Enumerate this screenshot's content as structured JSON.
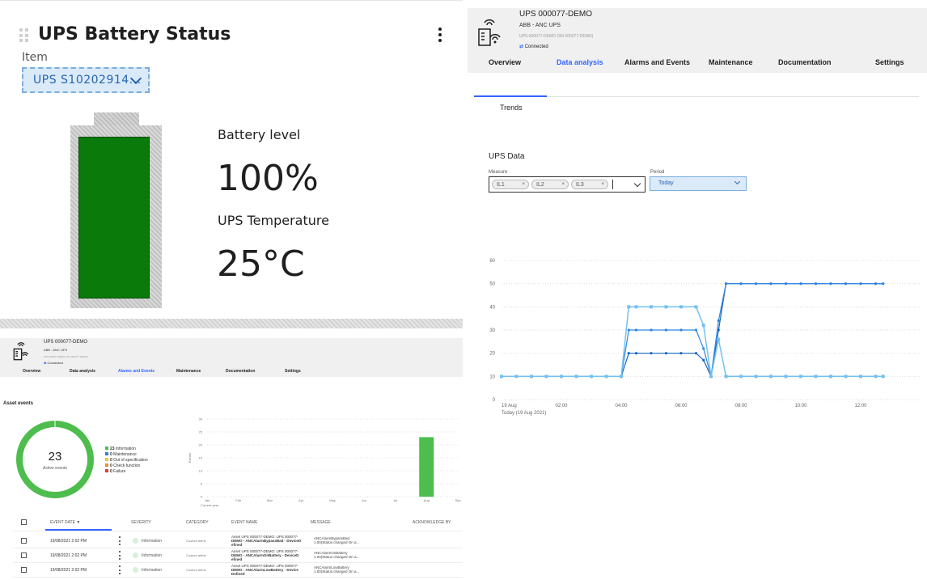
{
  "battery_widget": {
    "title": "UPS Battery Status",
    "item_label": "Item",
    "item_value": "UPS S10202914...",
    "battery_level_label": "Battery level",
    "battery_level_value": "100%",
    "battery_level_fraction": 1.0,
    "temperature_label": "UPS Temperature",
    "temperature_value": "25°C",
    "colors": {
      "battery_fill": "#0a7a0a",
      "select_bg": "#dbeaf8",
      "select_text": "#2566b0"
    },
    "icons": [
      "drag-handle-icon",
      "more-vertical-icon",
      "chevron-down-icon"
    ]
  },
  "asset_header": {
    "name": "UPS 000077-DEMO",
    "model": "ABB - ANC UPS",
    "serial": "UPS 000077-DEMO (SN 000077-DEMO)",
    "status": "Connected",
    "icons": [
      "ups-device-icon",
      "wifi-icon",
      "connected-arrows-icon"
    ]
  },
  "tabs": [
    {
      "label": "Overview"
    },
    {
      "label": "Data analysis"
    },
    {
      "label": "Alarms and Events"
    },
    {
      "label": "Maintenance"
    },
    {
      "label": "Documentation"
    },
    {
      "label": "Settings"
    }
  ],
  "data_analysis": {
    "subtab": "Trends",
    "section_title": "UPS Data",
    "measure_label": "Measure",
    "measure_tags": [
      "IL1",
      "IL2",
      "IL3"
    ],
    "period_label": "Period",
    "period_value": "Today",
    "x_caption": "Today (19 Aug 2021)",
    "colors": {
      "IL1": "#1565c0",
      "IL2": "#2e86de",
      "IL3": "#74c0f0"
    }
  },
  "chart_data": [
    {
      "type": "line",
      "title": "",
      "xlabel": "Today (19 Aug 2021)",
      "ylabel": "",
      "ylim": [
        0,
        60
      ],
      "y_ticks": [
        "0",
        "10",
        "20",
        "30",
        "40",
        "50",
        "60"
      ],
      "x_ticks": [
        "19 Aug",
        "02:00",
        "04:00",
        "06:00",
        "08:00",
        "10:00",
        "12:00"
      ],
      "x": [
        "00:00",
        "00:30",
        "01:00",
        "01:30",
        "02:00",
        "02:30",
        "03:00",
        "03:30",
        "04:00",
        "04:15",
        "04:30",
        "05:00",
        "05:30",
        "06:00",
        "06:30",
        "06:45",
        "07:00",
        "07:15",
        "07:30",
        "08:00",
        "08:30",
        "09:00",
        "09:30",
        "10:00",
        "10:30",
        "11:00",
        "11:30",
        "12:00",
        "12:30",
        "12:45"
      ],
      "series": [
        {
          "values": [
            10,
            10,
            10,
            10,
            10,
            10,
            10,
            10,
            10,
            20,
            20,
            20,
            20,
            20,
            20,
            17,
            10,
            30,
            50,
            50,
            50,
            50,
            50,
            50,
            50,
            50,
            50,
            50,
            50,
            50
          ]
        },
        {
          "values": [
            10,
            10,
            10,
            10,
            10,
            10,
            10,
            10,
            10,
            30,
            30,
            30,
            30,
            30,
            30,
            22,
            10,
            34,
            50,
            50,
            50,
            50,
            50,
            50,
            50,
            50,
            50,
            50,
            50,
            50
          ]
        },
        {
          "values": [
            10,
            10,
            10,
            10,
            10,
            10,
            10,
            10,
            10,
            40,
            40,
            40,
            40,
            40,
            40,
            32,
            10,
            26,
            10,
            10,
            10,
            10,
            10,
            10,
            10,
            10,
            10,
            10,
            10,
            10
          ]
        }
      ],
      "grid": true
    },
    {
      "type": "bar",
      "title": "",
      "xlabel": "Current year",
      "ylabel": "Events",
      "categories": [
        "Jan",
        "Feb",
        "Mar",
        "Apr",
        "May",
        "Jun",
        "Jul",
        "Aug",
        "Sep"
      ],
      "x_tick_labels": [
        "Jan",
        "Feb",
        "Mar",
        "Apr",
        "May",
        "Jun",
        "Jul",
        "Aug",
        "Sep"
      ],
      "values": [
        0,
        0,
        0,
        0,
        0,
        0,
        0,
        23,
        0
      ],
      "ylim": [
        0,
        30
      ],
      "y_ticks": [
        "0",
        "5",
        "10",
        "15",
        "20",
        "25",
        "30"
      ],
      "color": "#4dbd4d",
      "grid": true
    },
    {
      "type": "pie",
      "title": "",
      "center_value": "23",
      "center_label": "Active events",
      "legend": [
        {
          "count": "23",
          "label": "Information",
          "color": "#4dbd4d"
        },
        {
          "count": "0",
          "label": "Maintenance",
          "color": "#3a7fd5"
        },
        {
          "count": "0",
          "label": "Out of specification",
          "color": "#f5c242"
        },
        {
          "count": "0",
          "label": "Check function",
          "color": "#f08a30"
        },
        {
          "count": "0",
          "label": "Failure",
          "color": "#e03c31"
        }
      ],
      "values": [
        23,
        0,
        0,
        0,
        0
      ]
    }
  ],
  "events": {
    "section_title": "Asset events",
    "columns": [
      "EVENT DATE ▼",
      "SEVERITY",
      "CATEGORY",
      "EVENT NAME",
      "MESSAGE",
      "ACKNOWLEDGE BY"
    ],
    "rows": [
      {
        "date": "19/08/2021 2:02 PM",
        "severity": "Information",
        "category": "Custom alerts",
        "name_lines": [
          "Asset UPS 000077-DEMO: UPS 000077-",
          "DEMO - ANCAlarmBypassBad - DeviceD",
          "efined"
        ],
        "message_lines": [
          "ANCAlarmBypassBad",
          "1.00(Status changed On a..."
        ]
      },
      {
        "date": "19/08/2021 2:02 PM",
        "severity": "Information",
        "category": "Custom alerts",
        "name_lines": [
          "Asset UPS 000077-DEMO: UPS 000077-",
          "DEMO - ANCAlarmOnBattery - DeviceD",
          "efined"
        ],
        "message_lines": [
          "ANCAlarmOnBattery",
          "1.00(Status changed On a..."
        ]
      },
      {
        "date": "19/08/2021 2:02 PM",
        "severity": "Information",
        "category": "Custom alerts",
        "name_lines": [
          "Asset UPS 000077-DEMO: UPS 000077-",
          "DEMO - ANCAlarmLowBattery - Device",
          "Defined"
        ],
        "message_lines": [
          "ANCAlarmLowBattery",
          "1.00(Status changed On a..."
        ]
      }
    ]
  }
}
